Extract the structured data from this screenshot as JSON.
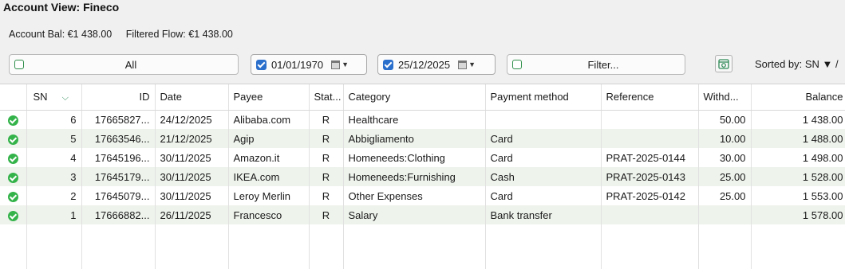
{
  "account": {
    "title": "Account View: Fineco",
    "balance_label": "Account Bal: €1 438.00",
    "flow_label": "Filtered Flow: €1 438.00"
  },
  "filters": {
    "all_label": "All",
    "date_from": "01/01/1970",
    "date_to": "25/12/2025",
    "filter_label": "Filter...",
    "sorted_by": "Sorted by: SN ▼ /"
  },
  "columns": [
    "SN",
    "ID",
    "Date",
    "Payee",
    "Stat...",
    "Category",
    "Payment method",
    "Reference",
    "Withd...",
    "Balance"
  ],
  "rows": [
    {
      "sn": "6",
      "id": "17665827...",
      "date": "24/12/2025",
      "payee": "Alibaba.com",
      "status": "R",
      "category": "Healthcare",
      "method": "",
      "reference": "",
      "withdrawal": "50.00",
      "balance": "1 438.00"
    },
    {
      "sn": "5",
      "id": "17663546...",
      "date": "21/12/2025",
      "payee": "Agip",
      "status": "R",
      "category": "Abbigliamento",
      "method": "Card",
      "reference": "",
      "withdrawal": "10.00",
      "balance": "1 488.00"
    },
    {
      "sn": "4",
      "id": "17645196...",
      "date": "30/11/2025",
      "payee": "Amazon.it",
      "status": "R",
      "category": "Homeneeds:Clothing",
      "method": "Card",
      "reference": "PRAT-2025-0144",
      "withdrawal": "30.00",
      "balance": "1 498.00"
    },
    {
      "sn": "3",
      "id": "17645179...",
      "date": "30/11/2025",
      "payee": "IKEA.com",
      "status": "R",
      "category": "Homeneeds:Furnishing",
      "method": "Cash",
      "reference": "PRAT-2025-0143",
      "withdrawal": "25.00",
      "balance": "1 528.00"
    },
    {
      "sn": "2",
      "id": "17645079...",
      "date": "30/11/2025",
      "payee": "Leroy Merlin",
      "status": "R",
      "category": "Other Expenses",
      "method": "Card",
      "reference": "PRAT-2025-0142",
      "withdrawal": "25.00",
      "balance": "1 553.00"
    },
    {
      "sn": "1",
      "id": "17666882...",
      "date": "26/11/2025",
      "payee": "Francesco",
      "status": "R",
      "category": "Salary",
      "method": "Bank transfer",
      "reference": "",
      "withdrawal": "",
      "balance": "1 578.00"
    }
  ],
  "icons": {
    "reconciled": "check-circle-icon",
    "calendar": "calendar-icon",
    "refresh": "calendar-refresh-icon"
  },
  "colors": {
    "accent_green": "#34b34a",
    "checkbox_blue": "#2b6fcc",
    "alt_row": "#eef3ec"
  }
}
